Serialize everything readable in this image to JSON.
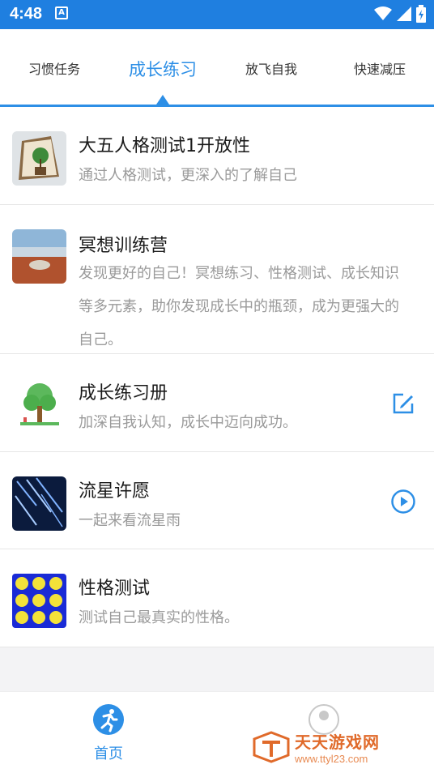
{
  "status_bar": {
    "time": "4:48",
    "notif_letter": "A"
  },
  "tabs": [
    {
      "label": "习惯任务"
    },
    {
      "label": "成长练习"
    },
    {
      "label": "放飞自我"
    },
    {
      "label": "快速减压"
    }
  ],
  "items": [
    {
      "title": "大五人格测试1开放性",
      "desc": "通过人格测试，更深入的了解自己"
    },
    {
      "title": "冥想训练营",
      "desc": "发现更好的自己！冥想练习、性格测试、成长知识等多元素，助你发现成长中的瓶颈，成为更强大的自己。"
    },
    {
      "title": "成长练习册",
      "desc": "加深自我认知，成长中迈向成功。"
    },
    {
      "title": "流星许愿",
      "desc": "一起来看流星雨"
    },
    {
      "title": "性格测试",
      "desc": "测试自己最真实的性格。"
    }
  ],
  "bottom_nav": {
    "home_label": "首页"
  },
  "watermark": {
    "title": "天天游戏网",
    "url": "www.ttyl23.com"
  },
  "colors": {
    "accent": "#2d8fe6",
    "status_bar": "#1f7fe0"
  }
}
